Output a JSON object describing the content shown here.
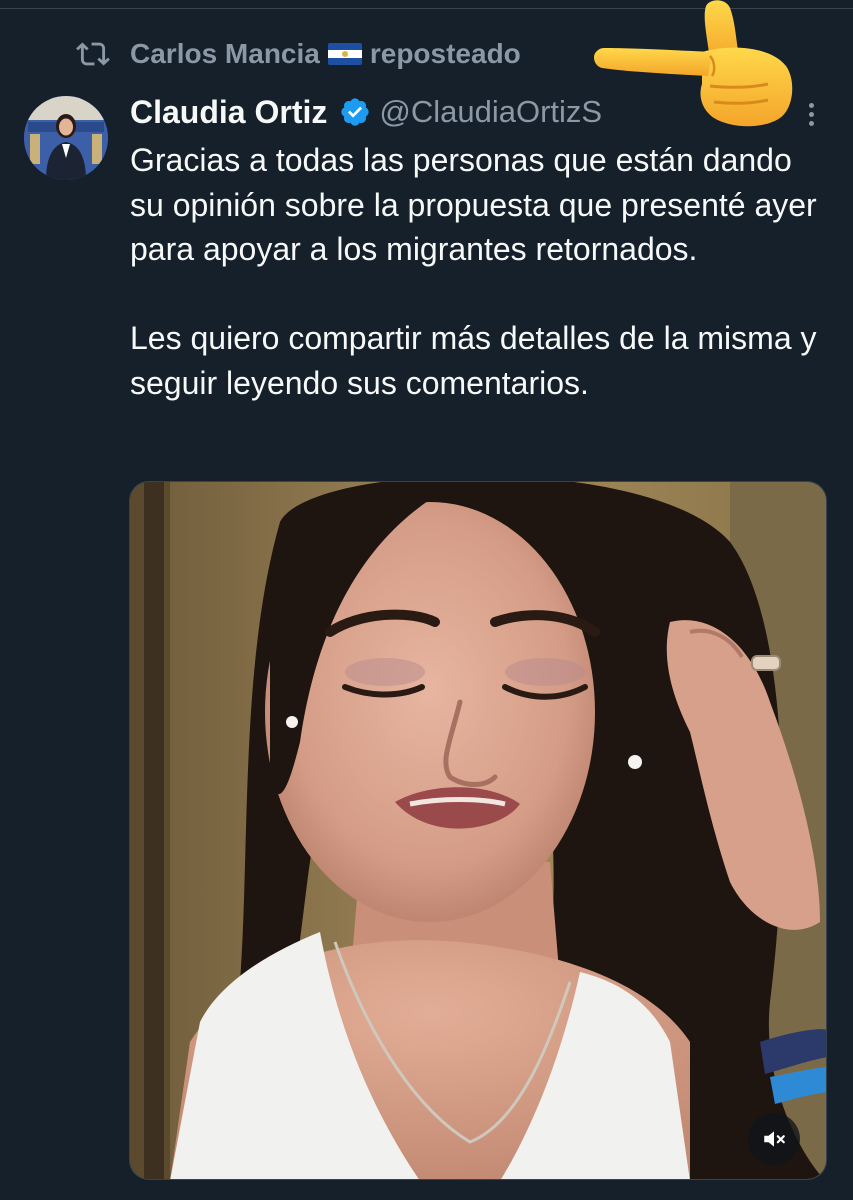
{
  "repost": {
    "icon": "repost-icon",
    "user_name": "Carlos Mancia",
    "flag": "el-salvador-flag",
    "label": "reposteado"
  },
  "tweet": {
    "author_name": "Claudia Ortiz",
    "verified": true,
    "handle": "@ClaudiaOrtizS",
    "more_icon": "more-vertical-icon",
    "paragraph_1": "Gracias a todas las personas que están dando su opinión sobre la propuesta que presenté ayer para apoyar a los migrantes retornados.",
    "paragraph_2": "Les quiero compartir más detalles de la misma y seguir leyendo sus comentarios."
  },
  "media": {
    "type": "video",
    "mute_icon": "volume-muted-icon"
  },
  "colors": {
    "background": "#15202b",
    "text": "#f7f9f9",
    "secondary_text": "#8b98a5",
    "verified_blue": "#1d9bf0"
  }
}
